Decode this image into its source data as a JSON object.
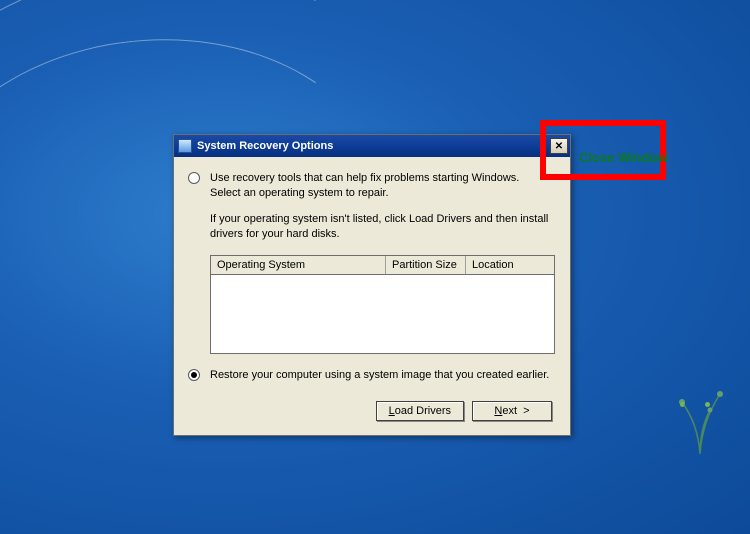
{
  "dialog": {
    "title": "System Recovery Options",
    "option1": "Use recovery tools that can help fix problems starting Windows. Select an operating system to repair.",
    "subtext": "If your operating system isn't listed, click Load Drivers and then install drivers for your hard disks.",
    "columns": {
      "os": "Operating System",
      "partition": "Partition Size",
      "location": "Location"
    },
    "option2": "Restore your computer using a system image that you created earlier.",
    "buttons": {
      "load_drivers": "Load Drivers",
      "load_drivers_key": "L",
      "next": "Next >",
      "next_key": "N"
    },
    "selected_option": 2
  },
  "annotation": {
    "label": "Close Window"
  }
}
